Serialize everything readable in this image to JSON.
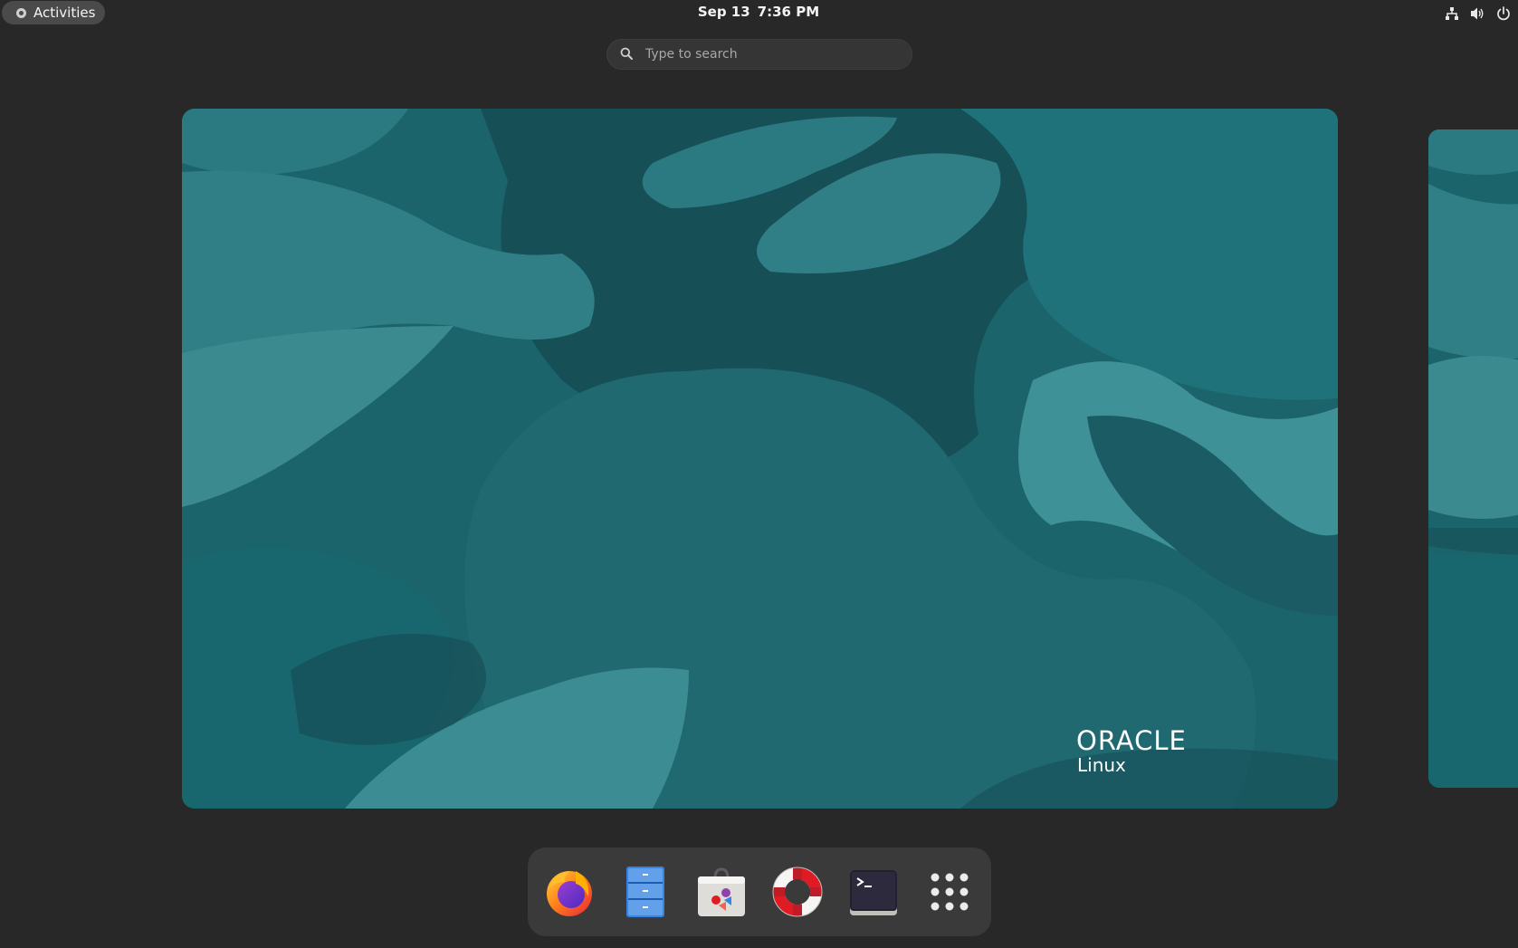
{
  "topbar": {
    "activities_label": "Activities",
    "date": "Sep 13",
    "time": "7:36 PM",
    "tray_icons": [
      "network-icon",
      "volume-icon",
      "power-icon"
    ]
  },
  "search": {
    "placeholder": "Type to search"
  },
  "workspace": {
    "logo_brand": "ORACLE",
    "logo_product": "Linux"
  },
  "dash": {
    "apps": [
      {
        "name": "Firefox",
        "icon": "firefox-icon"
      },
      {
        "name": "Files",
        "icon": "files-icon"
      },
      {
        "name": "Software",
        "icon": "software-icon"
      },
      {
        "name": "Help",
        "icon": "help-icon"
      },
      {
        "name": "Terminal",
        "icon": "terminal-icon"
      },
      {
        "name": "Show Applications",
        "icon": "app-grid-icon"
      }
    ]
  },
  "colors": {
    "panel_bg": "#282828",
    "wallpaper_teal": "#1e6a72",
    "dash_bg": "#3a3a3a"
  }
}
